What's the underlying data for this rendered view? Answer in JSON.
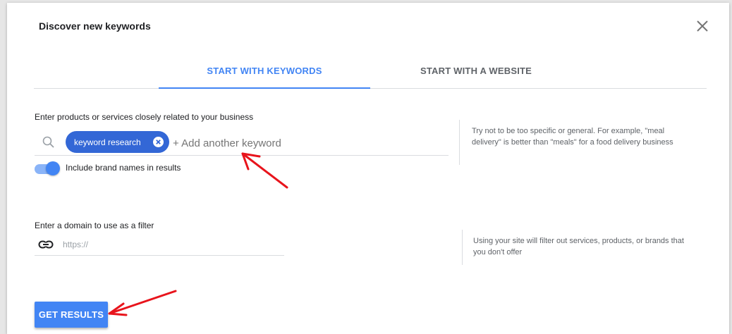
{
  "dialog": {
    "title": "Discover new keywords",
    "close_icon": "close-icon"
  },
  "tabs": [
    {
      "label": "START WITH KEYWORDS",
      "active": true
    },
    {
      "label": "START WITH A WEBSITE",
      "active": false
    }
  ],
  "keywords": {
    "label": "Enter products or services closely related to your business",
    "search_icon": "search-icon",
    "chips": [
      {
        "label": "keyword research",
        "remove_icon": "close-circle-icon"
      }
    ],
    "placeholder": "+ Add another keyword",
    "value": "",
    "hint": "Try not to be too specific or general. For example, \"meal delivery\" is better than \"meals\" for a food delivery business"
  },
  "brand_toggle": {
    "label": "Include brand names in results",
    "checked": true
  },
  "domain": {
    "label": "Enter a domain to use as a filter",
    "link_icon": "link-icon",
    "placeholder": "https://",
    "value": "",
    "hint": "Using your site will filter out services, products, or brands that you don't offer"
  },
  "actions": {
    "get_results_label": "GET RESULTS"
  },
  "colors": {
    "accent": "#4285f4",
    "chip": "#3367d6",
    "annotation_arrow": "#e8141c"
  }
}
